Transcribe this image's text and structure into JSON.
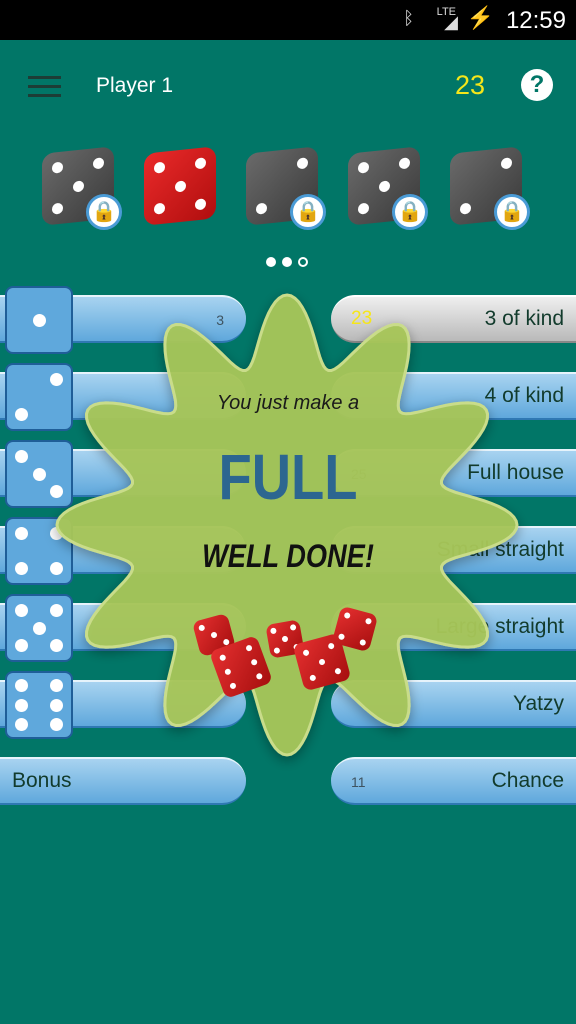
{
  "status_bar": {
    "time": "12:59",
    "network": "LTE",
    "icons": [
      "bluetooth-icon",
      "signal-icon",
      "battery-charging-icon"
    ]
  },
  "header": {
    "player": "Player 1",
    "score": "23",
    "help": "?"
  },
  "held_dice": [
    {
      "value": 5,
      "color": "gray",
      "locked": true
    },
    {
      "value": 5,
      "color": "red",
      "locked": false
    },
    {
      "value": 2,
      "color": "gray",
      "locked": true
    },
    {
      "value": 5,
      "color": "gray",
      "locked": true
    },
    {
      "value": 2,
      "color": "gray",
      "locked": true
    }
  ],
  "page_indicator": {
    "count": 3,
    "active": [
      0,
      1
    ]
  },
  "upper": [
    {
      "face": 1,
      "value": "3"
    },
    {
      "face": 2,
      "value": ""
    },
    {
      "face": 3,
      "value": ""
    },
    {
      "face": 4,
      "value": ""
    },
    {
      "face": 5,
      "value": ""
    },
    {
      "face": 6,
      "value": ""
    }
  ],
  "bonus": {
    "label": "Bonus"
  },
  "lower": [
    {
      "label": "3 of kind",
      "value": "23",
      "selected": true
    },
    {
      "label": "4 of kind",
      "value": ""
    },
    {
      "label": "Full house",
      "value": "25"
    },
    {
      "label": "Small straight",
      "value": ""
    },
    {
      "label": "Large straight",
      "value": ""
    },
    {
      "label": "Yatzy",
      "value": ""
    },
    {
      "label": "Chance",
      "value": "11"
    }
  ],
  "popup": {
    "line1": "You just make a",
    "combo": "FULL",
    "line2": "WELL DONE!",
    "color": "#a8c65a"
  },
  "colors": {
    "background": "#017667",
    "score": "#f5e61a",
    "bar": "#5fa8dc"
  }
}
